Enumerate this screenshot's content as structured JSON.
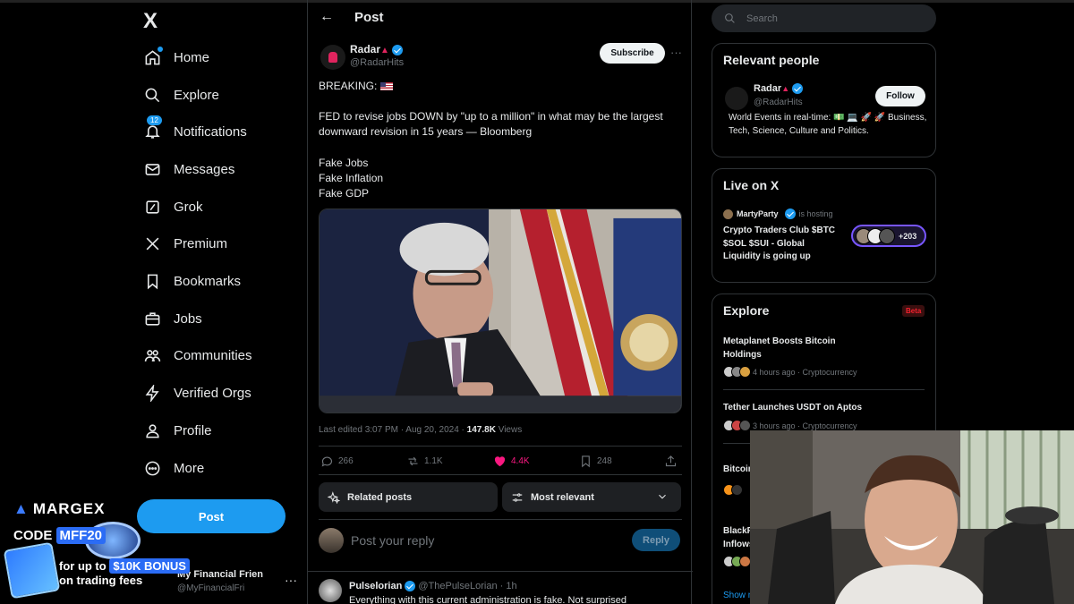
{
  "sidebar": {
    "logo": "X",
    "items": [
      {
        "label": "Home",
        "icon": "home-icon"
      },
      {
        "label": "Explore",
        "icon": "search-icon"
      },
      {
        "label": "Notifications",
        "icon": "bell-icon",
        "badge": "12"
      },
      {
        "label": "Messages",
        "icon": "mail-icon"
      },
      {
        "label": "Grok",
        "icon": "grok-icon"
      },
      {
        "label": "Premium",
        "icon": "x-icon"
      },
      {
        "label": "Bookmarks",
        "icon": "bookmark-icon"
      },
      {
        "label": "Jobs",
        "icon": "briefcase-icon"
      },
      {
        "label": "Communities",
        "icon": "people-icon"
      },
      {
        "label": "Verified Orgs",
        "icon": "lightning-icon"
      },
      {
        "label": "Profile",
        "icon": "person-icon"
      },
      {
        "label": "More",
        "icon": "more-circle-icon"
      }
    ],
    "post_button": "Post",
    "account": {
      "name": "My Financial Frien",
      "handle": "@MyFinancialFri",
      "more": "···"
    }
  },
  "ad": {
    "brand": "MARGEX",
    "code_prefix": "CODE",
    "code": "MFF20",
    "line1_prefix": "for up to",
    "bonus": "$10K BONUS",
    "line2": "on trading fees"
  },
  "main": {
    "back": "←",
    "title": "Post",
    "author": {
      "name": "Radar",
      "handle": "@RadarHits"
    },
    "subscribe": "Subscribe",
    "more": "···",
    "text": {
      "breaking": "BREAKING:",
      "body": "FED to revise jobs DOWN by \"up to a million\" in what may be the largest downward revision in 15 years — Bloomberg",
      "line1": "Fake Jobs",
      "line2": "Fake Inflation",
      "line3": "Fake GDP"
    },
    "meta": {
      "edited": "Last edited 3:07 PM · Aug 20, 2024 ·",
      "views": "147.8K",
      "views_label": "Views"
    },
    "stats": {
      "replies": "266",
      "reposts": "1.1K",
      "likes": "4.4K",
      "bookmarks": "248"
    },
    "related_posts": "Related posts",
    "most_relevant": "Most relevant",
    "reply_placeholder": "Post your reply",
    "reply_button": "Reply",
    "reply": {
      "name": "Pulselorian",
      "handle": "@ThePulseLorian · 1h",
      "text": "Everything with this current administration is fake. Not surprised"
    }
  },
  "right": {
    "search_placeholder": "Search",
    "relevant": {
      "title": "Relevant people",
      "name": "Radar",
      "handle": "@RadarHits",
      "follow": "Follow",
      "bio": "World Events in real-time: 💵 💻 🚀 🚀 Business, Tech, Science, Culture and Politics."
    },
    "live": {
      "title": "Live on X",
      "host": "MartyParty",
      "hosting": "is hosting",
      "space_title": "Crypto Traders Club $BTC $SOL $SUI - Global Liquidity is going up",
      "count": "+203"
    },
    "explore": {
      "title": "Explore",
      "badge": "Beta",
      "items": [
        {
          "title": "Metaplanet Boosts Bitcoin Holdings",
          "meta": "4 hours ago · Cryptocurrency"
        },
        {
          "title": "Tether Launches USDT on Aptos",
          "meta": "3 hours ago · Cryptocurrency"
        },
        {
          "title": "Bitcoin",
          "meta": ""
        },
        {
          "title": "BlackR Inflows",
          "meta": ""
        }
      ],
      "show_more": "Show m"
    }
  },
  "colors": {
    "accent": "#1d9bf0",
    "like": "#f91880",
    "background": "#000000"
  }
}
